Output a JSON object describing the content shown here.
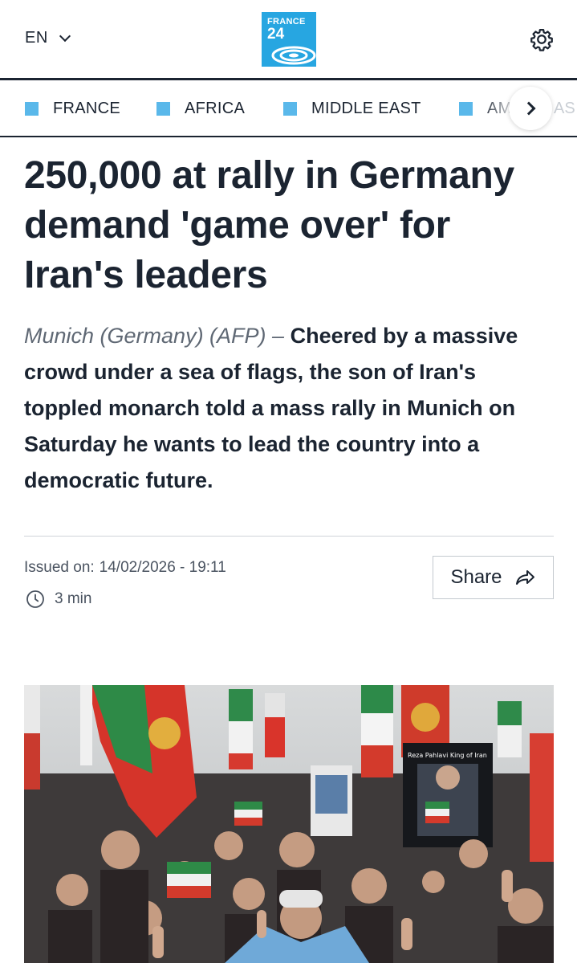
{
  "header": {
    "language": "EN",
    "logo": {
      "line1": "FRANCE",
      "line2": "24"
    },
    "settings_icon": "gear-icon"
  },
  "nav": {
    "items": [
      {
        "label": "FRANCE"
      },
      {
        "label": "AFRICA"
      },
      {
        "label": "MIDDLE EAST"
      },
      {
        "label": "AM"
      }
    ],
    "overflow_label": "AS",
    "next_icon": "chevron-right-icon",
    "square_color": "#5ab8ea"
  },
  "article": {
    "title": "250,000 at rally in Germany demand 'game over' for Iran's leaders",
    "dateline": "Munich (Germany) (AFP) –",
    "lead": "Cheered by a massive crowd under a sea of flags, the son of Iran's toppled monarch told a mass rally in Munich on Saturday he wants to lead the country into a democratic future.",
    "issued_label": "Issued on:",
    "issued_value": "14/02/2026 - 19:11",
    "read_time": "3 min",
    "share_label": "Share"
  },
  "photo": {
    "sign_text": "Reza Pahlavi King of Iran"
  },
  "colors": {
    "brand_blue": "#27a6e1",
    "text_dark": "#1b2431",
    "meta_gray": "#4a5360"
  }
}
